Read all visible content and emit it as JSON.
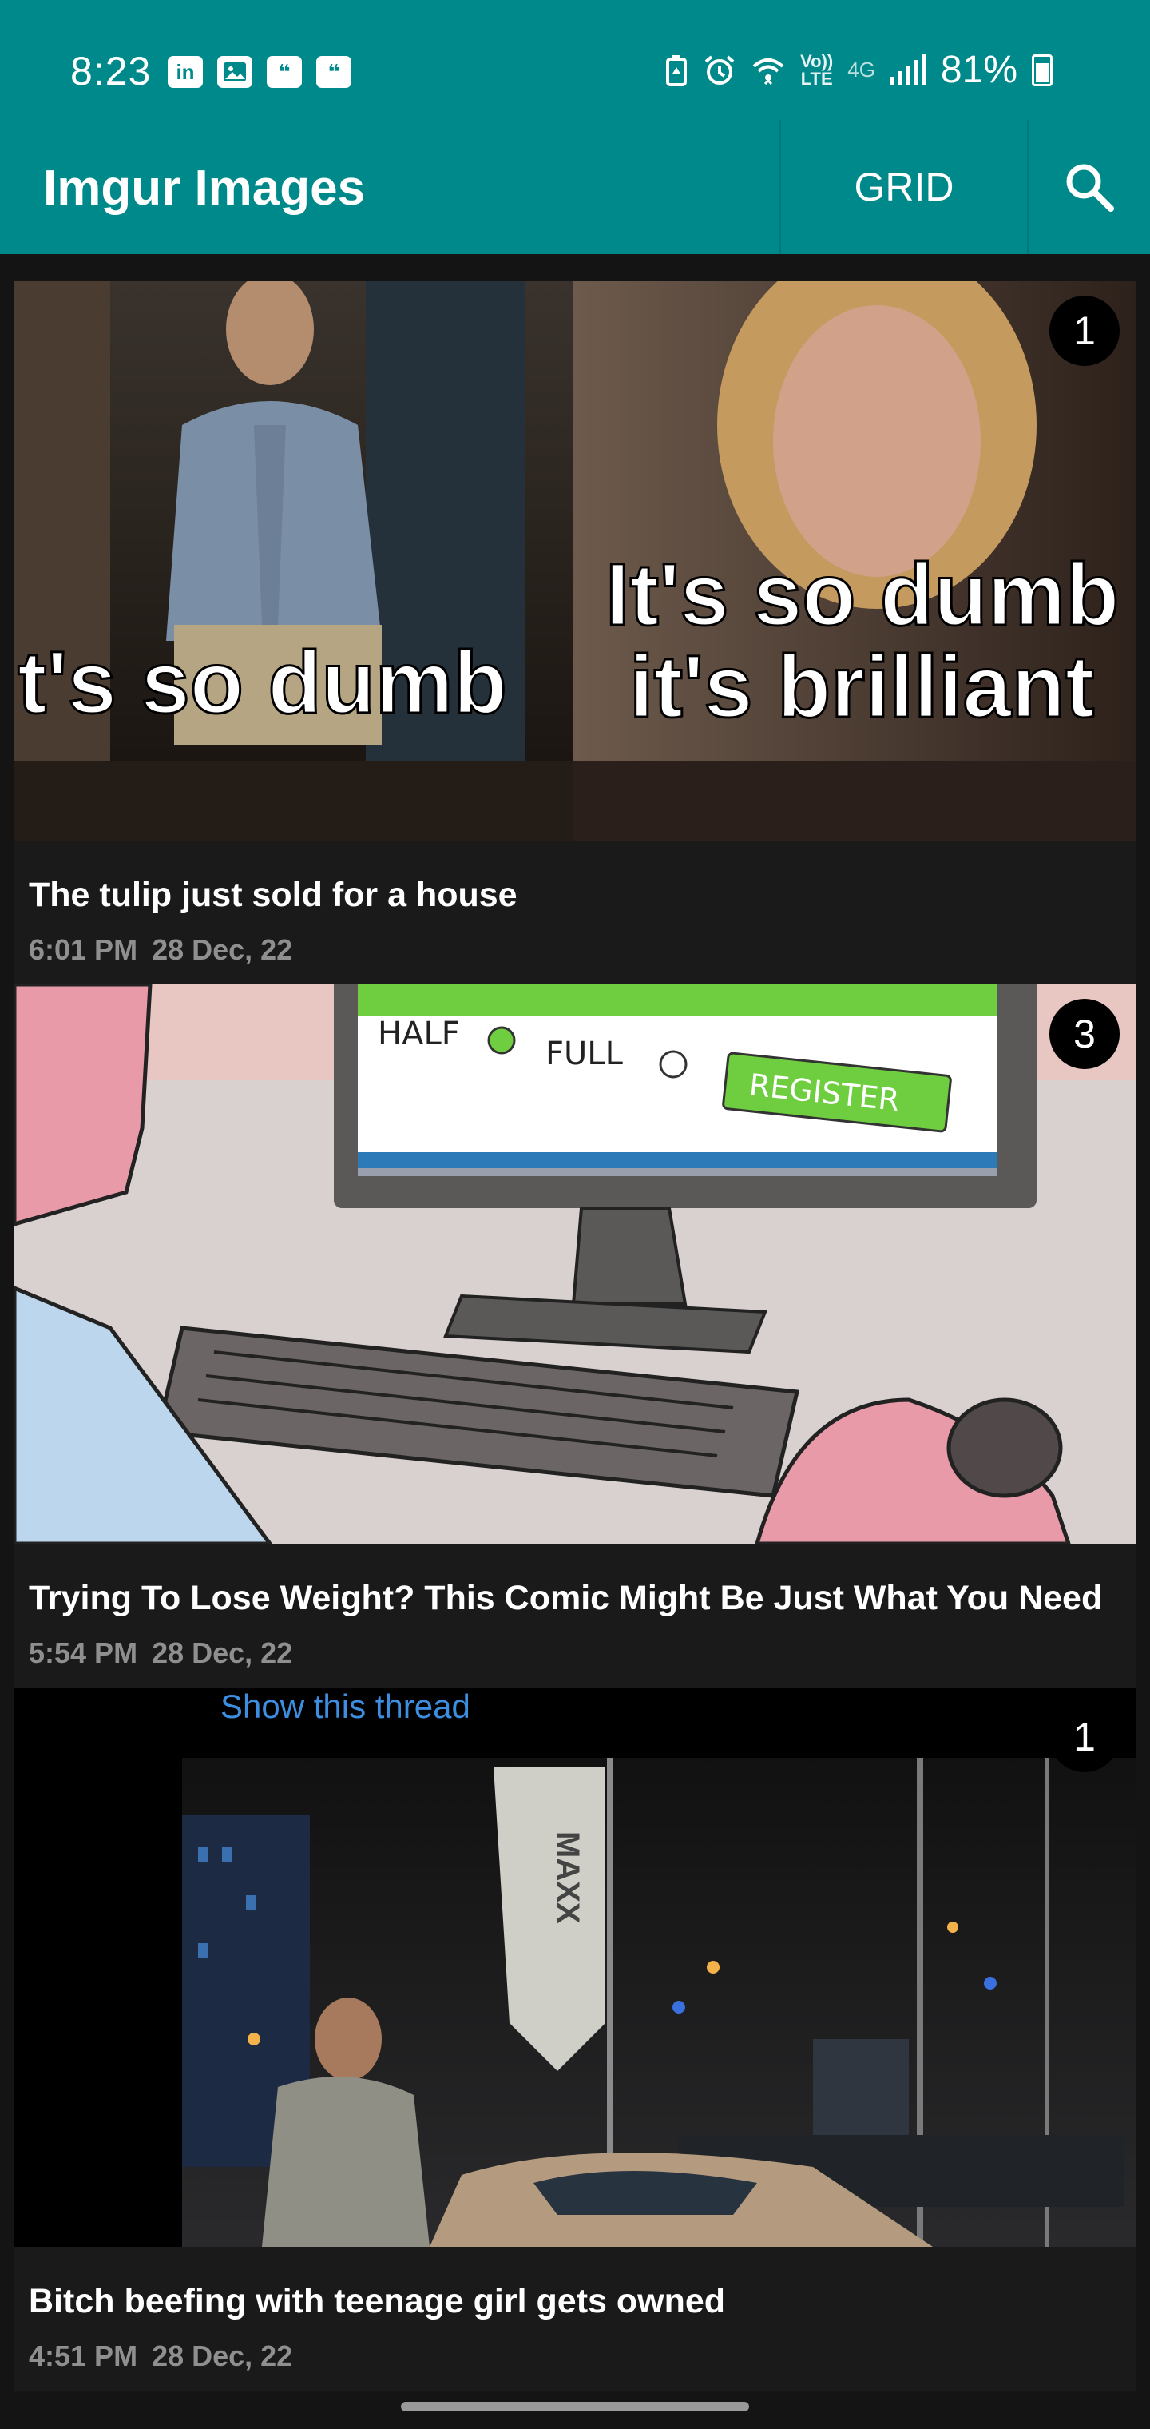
{
  "status_bar": {
    "time": "8:23",
    "notification_icons": [
      "linkedin-icon",
      "image-icon",
      "hangouts-icon",
      "hangouts-icon"
    ],
    "volte_top": "Vo))",
    "volte_bottom": "LTE",
    "network": "4G",
    "battery": "81%"
  },
  "app_bar": {
    "title": "Imgur Images",
    "grid_label": "GRID",
    "search_icon": "search-icon"
  },
  "posts": [
    {
      "title": "The tulip just sold for a house",
      "time": "6:01 PM",
      "date": "28 Dec, 22",
      "count": "1",
      "caption_left": "t's so dumb",
      "caption_right_1": "It's so dumb",
      "caption_right_2": "it's brilliant"
    },
    {
      "title": "Trying To Lose Weight? This Comic Might Be Just What You Need",
      "time": "5:54 PM",
      "date": "28 Dec, 22",
      "count": "3",
      "screen_half": "HALF",
      "screen_full": "FULL",
      "screen_register": "REGISTER"
    },
    {
      "title": "Bitch beefing with teenage girl gets owned",
      "time": "4:51 PM",
      "date": "28 Dec, 22",
      "count": "1",
      "thread_link": "Show this thread",
      "flag_text": "MAXX"
    }
  ],
  "colors": {
    "app_bar": "#00898a",
    "background": "#141414",
    "card": "#1a1a1a",
    "meta_text": "#8f8f8f"
  }
}
